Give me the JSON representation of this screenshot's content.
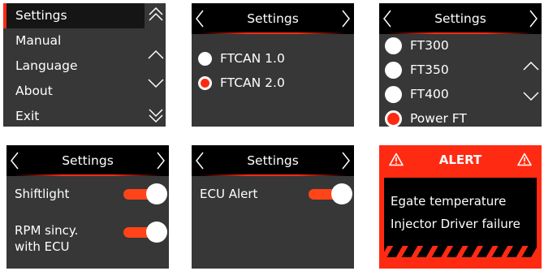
{
  "menu": {
    "items": [
      "Settings",
      "Manual",
      "Language",
      "About",
      "Exit"
    ],
    "selected": "Settings",
    "side_icons": [
      "double-chevron-up-icon",
      "chevron-up-icon",
      "chevron-down-icon",
      "double-chevron-down-icon"
    ]
  },
  "can_settings": {
    "title": "Settings",
    "options": [
      {
        "label": "FTCAN 1.0",
        "selected": false
      },
      {
        "label": "FTCAN 2.0",
        "selected": true
      }
    ]
  },
  "model_settings": {
    "title": "Settings",
    "options": [
      {
        "label": "FT300",
        "selected": false
      },
      {
        "label": "FT350",
        "selected": false
      },
      {
        "label": "FT400",
        "selected": false
      },
      {
        "label": "Power FT",
        "selected": true
      }
    ]
  },
  "shift_settings": {
    "title": "Settings",
    "shiftlight_label": "Shiftlight",
    "shiftlight_on": true,
    "rpm_label_line1": "RPM sincy.",
    "rpm_label_line2": "with ECU",
    "rpm_on": true
  },
  "ecu_settings": {
    "title": "Settings",
    "ecu_alert_label": "ECU Alert",
    "ecu_alert_on": true
  },
  "alert": {
    "title": "ALERT",
    "lines": [
      "Egate temperature",
      "Injector Driver failure"
    ]
  },
  "colors": {
    "accent": "#ff2a12",
    "screen_bg": "#373737",
    "header_bg": "#000000",
    "text": "#ffffff"
  }
}
